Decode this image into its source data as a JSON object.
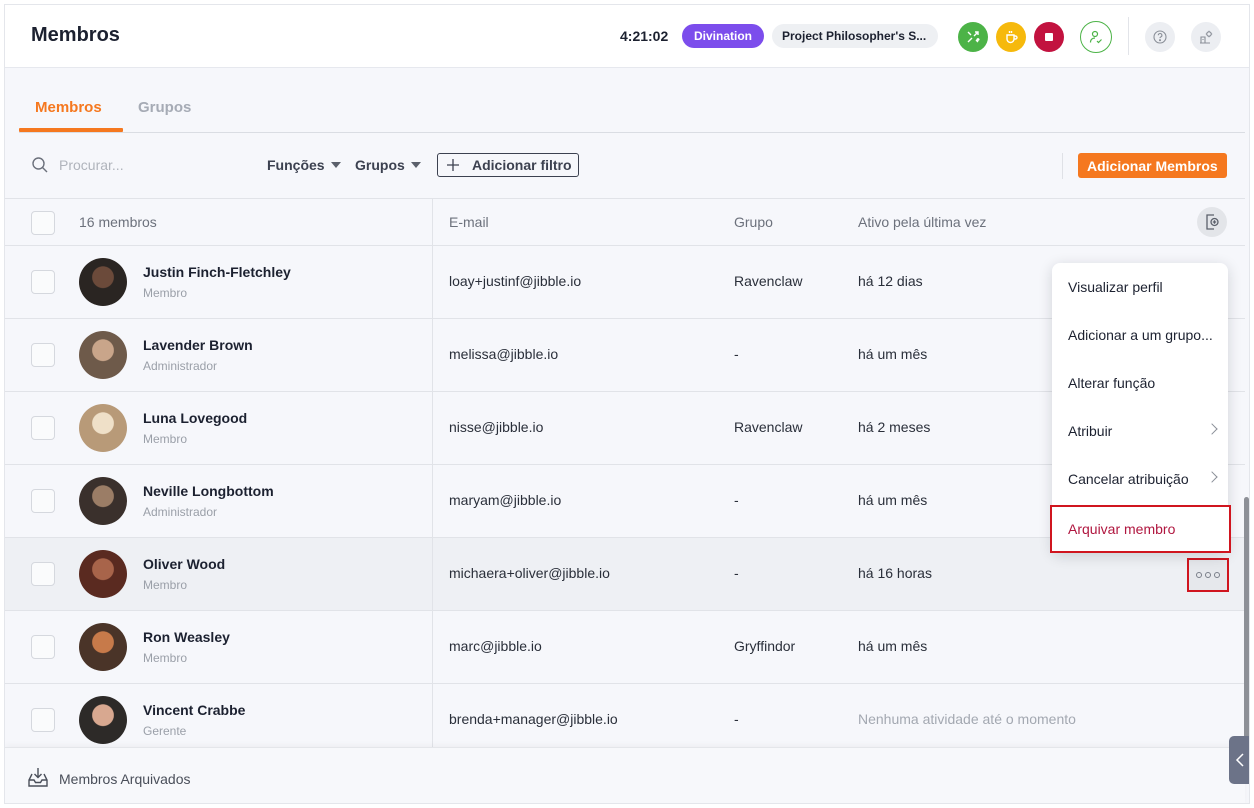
{
  "header": {
    "title": "Membros",
    "timer": "4:21:02",
    "activity": "Divination",
    "project": "Project Philosopher's S...",
    "icons": [
      "switch-activity-icon",
      "coffee-break-icon",
      "stop-icon",
      "user-check-icon",
      "help-icon",
      "organization-icon"
    ],
    "colors": {
      "activity": "#7c4dec",
      "switch": "#4cb347",
      "break": "#f6b90c",
      "stop": "#c2123f"
    }
  },
  "tabs": [
    {
      "label": "Membros",
      "active": true
    },
    {
      "label": "Grupos",
      "active": false
    }
  ],
  "toolbar": {
    "search_placeholder": "Procurar...",
    "roles_label": "Funções",
    "groups_label": "Grupos",
    "add_filter_label": "Adicionar filtro",
    "add_members_label": "Adicionar Membros",
    "accent": "#f5781f"
  },
  "table": {
    "count_label": "16 membros",
    "columns": {
      "email": "E-mail",
      "group": "Grupo",
      "last_active": "Ativo pela última vez"
    },
    "rows": [
      {
        "name": "Justin Finch-Fletchley",
        "role": "Membro",
        "email": "loay+justinf@jibble.io",
        "group": "Ravenclaw",
        "last_active": "há 12 dias"
      },
      {
        "name": "Lavender Brown",
        "role": "Administrador",
        "email": "melissa@jibble.io",
        "group": "-",
        "last_active": "há um mês"
      },
      {
        "name": "Luna Lovegood",
        "role": "Membro",
        "email": "nisse@jibble.io",
        "group": "Ravenclaw",
        "last_active": "há 2 meses"
      },
      {
        "name": "Neville Longbottom",
        "role": "Administrador",
        "email": "maryam@jibble.io",
        "group": "-",
        "last_active": "há um mês"
      },
      {
        "name": "Oliver Wood",
        "role": "Membro",
        "email": "michaera+oliver@jibble.io",
        "group": "-",
        "last_active": "há 16 horas"
      },
      {
        "name": "Ron Weasley",
        "role": "Membro",
        "email": "marc@jibble.io",
        "group": "Gryffindor",
        "last_active": "há um mês"
      },
      {
        "name": "Vincent Crabbe",
        "role": "Gerente",
        "email": "brenda+manager@jibble.io",
        "group": "-",
        "last_active": "Nenhuma atividade até o momento"
      }
    ]
  },
  "context_menu": {
    "items": [
      {
        "label": "Visualizar perfil",
        "submenu": false
      },
      {
        "label": "Adicionar a um grupo...",
        "submenu": false
      },
      {
        "label": "Alterar função",
        "submenu": false
      },
      {
        "label": "Atribuir",
        "submenu": true
      },
      {
        "label": "Cancelar atribuição",
        "submenu": true
      },
      {
        "label": "Arquivar membro",
        "submenu": false,
        "highlighted": true
      }
    ]
  },
  "footer": {
    "archived_label": "Membros Arquivados"
  }
}
